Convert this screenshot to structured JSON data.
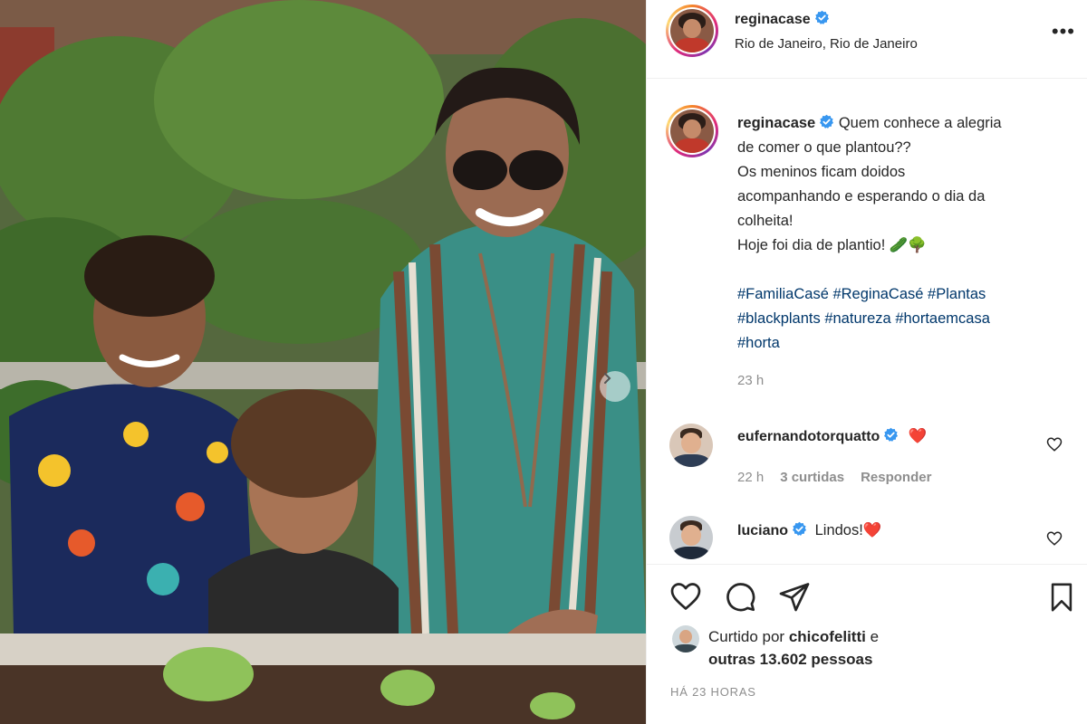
{
  "post": {
    "username": "reginacase",
    "location": "Rio de Janeiro, Rio de Janeiro",
    "more_label": "•••",
    "caption_lines": [
      "Quem conhece a alegria",
      "de comer o que plantou??",
      "Os meninos ficam doidos",
      "acompanhando e esperando o dia da",
      "colheita!",
      "Hoje foi dia de plantio! 🥒🌳"
    ],
    "hashtags": [
      "#FamiliaCasé",
      "#ReginaCasé",
      "#Plantas",
      "#blackplants",
      "#natureza",
      "#hortaemcasa",
      "#horta"
    ],
    "time": "23 h"
  },
  "comments": [
    {
      "username": "eufernandotorquatto",
      "text": "❤️",
      "time": "22 h",
      "likes": "3 curtidas",
      "reply_label": "Responder"
    },
    {
      "username": "luciano",
      "text": "Lindos!❤️"
    }
  ],
  "likes": {
    "prefix": "Curtido por",
    "liker": "chicofelitti",
    "suffix": "e",
    "others": "outras 13.602 pessoas"
  },
  "posted_ago": "HÁ 23 HORAS",
  "colors": {
    "hashtag": "#00376b",
    "verified": "#3897f0",
    "heart": "#ed4956",
    "muted": "#8e8e8e"
  },
  "icons": {
    "verified": "verified-badge-icon",
    "like": "heart-outline-icon",
    "comment": "comment-bubble-icon",
    "share": "paper-plane-icon",
    "save": "bookmark-icon",
    "next": "chevron-right-icon",
    "more": "more-options-icon"
  }
}
